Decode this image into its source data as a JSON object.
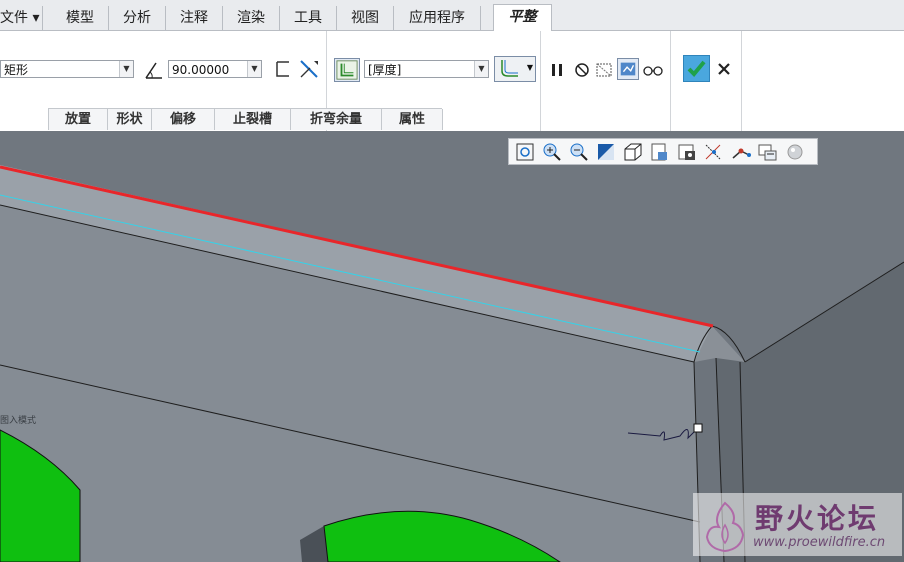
{
  "tabs": [
    {
      "label": "文件 ▾"
    },
    {
      "label": "模型"
    },
    {
      "label": "分析"
    },
    {
      "label": "注释"
    },
    {
      "label": "渲染"
    },
    {
      "label": "工具"
    },
    {
      "label": "视图"
    },
    {
      "label": "应用程序"
    },
    {
      "label": "平整"
    }
  ],
  "ribbon": {
    "shape_dropdown": {
      "value": "矩形"
    },
    "angle_value": "90.00000",
    "thickness_dropdown": {
      "value": "[厚度]"
    },
    "groups": [
      "放置",
      "形状",
      "偏移",
      "止裂槽",
      "折弯余量",
      "属性"
    ]
  },
  "viewport": {
    "annotation_text": "图入模式"
  },
  "watermark": {
    "title": "野火论坛",
    "url": "www.proewildfire.cn"
  },
  "colors": {
    "background": "#8a9097",
    "highlight_edge": "#e8262a",
    "tangent_edge": "#36d2e8",
    "green_surface": "#0fbf10",
    "accent_check": "#1fa14a"
  }
}
